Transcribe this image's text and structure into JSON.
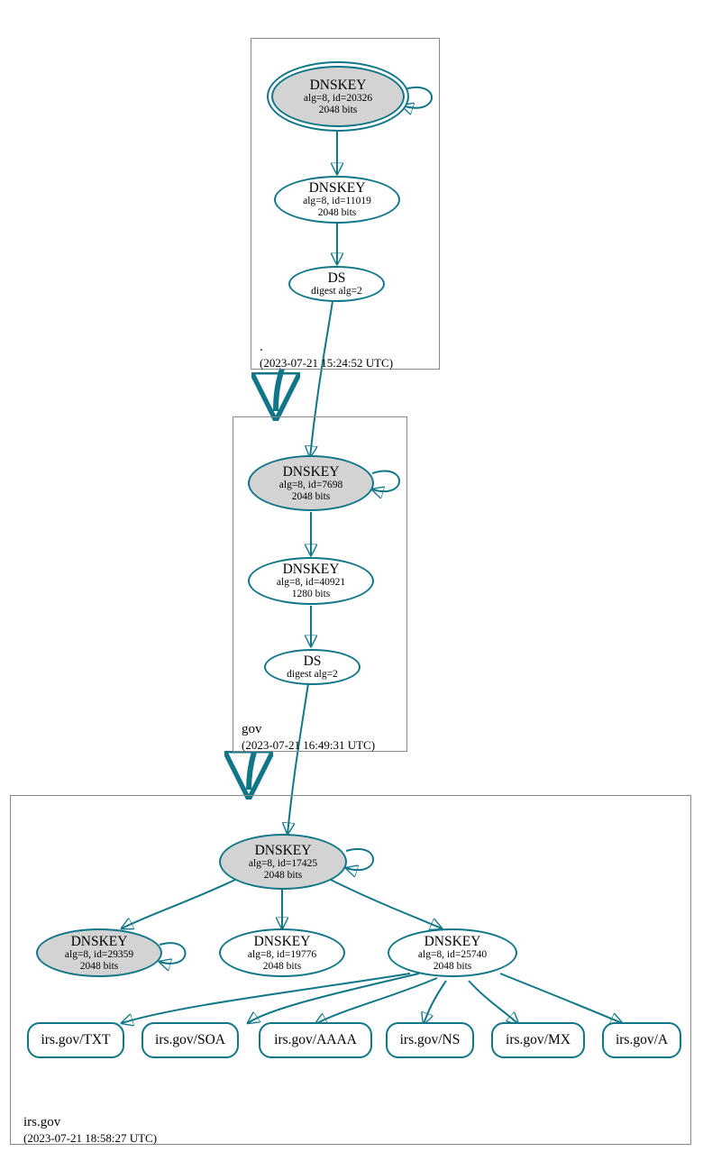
{
  "zones": {
    "root": {
      "label": ".",
      "timestamp": "(2023-07-21 15:24:52 UTC)"
    },
    "gov": {
      "label": "gov",
      "timestamp": "(2023-07-21 16:49:31 UTC)"
    },
    "irs": {
      "label": "irs.gov",
      "timestamp": "(2023-07-21 18:58:27 UTC)"
    }
  },
  "nodes": {
    "root_ksk": {
      "title": "DNSKEY",
      "sub1": "alg=8, id=20326",
      "sub2": "2048 bits"
    },
    "root_zsk": {
      "title": "DNSKEY",
      "sub1": "alg=8, id=11019",
      "sub2": "2048 bits"
    },
    "root_ds": {
      "title": "DS",
      "sub1": "digest alg=2"
    },
    "gov_ksk": {
      "title": "DNSKEY",
      "sub1": "alg=8, id=7698",
      "sub2": "2048 bits"
    },
    "gov_zsk": {
      "title": "DNSKEY",
      "sub1": "alg=8, id=40921",
      "sub2": "1280 bits"
    },
    "gov_ds": {
      "title": "DS",
      "sub1": "digest alg=2"
    },
    "irs_ksk": {
      "title": "DNSKEY",
      "sub1": "alg=8, id=17425",
      "sub2": "2048 bits"
    },
    "irs_key2": {
      "title": "DNSKEY",
      "sub1": "alg=8, id=29359",
      "sub2": "2048 bits"
    },
    "irs_key3": {
      "title": "DNSKEY",
      "sub1": "alg=8, id=19776",
      "sub2": "2048 bits"
    },
    "irs_key4": {
      "title": "DNSKEY",
      "sub1": "alg=8, id=25740",
      "sub2": "2048 bits"
    }
  },
  "records": {
    "txt": "irs.gov/TXT",
    "soa": "irs.gov/SOA",
    "aaaa": "irs.gov/AAAA",
    "ns": "irs.gov/NS",
    "mx": "irs.gov/MX",
    "a": "irs.gov/A"
  }
}
